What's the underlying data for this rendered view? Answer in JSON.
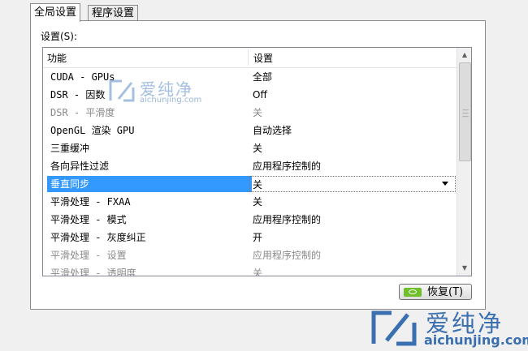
{
  "tabs": [
    {
      "label": "全局设置"
    },
    {
      "label": "程序设置"
    }
  ],
  "settings_label": "设置(S):",
  "table": {
    "columns": [
      "功能",
      "设置"
    ],
    "rows": [
      {
        "feature": "CUDA - GPUs",
        "value": "全部"
      },
      {
        "feature": "DSR - 因数",
        "value": "Off"
      },
      {
        "feature": "DSR - 平滑度",
        "value": "关"
      },
      {
        "feature": "OpenGL 渲染 GPU",
        "value": "自动选择"
      },
      {
        "feature": "三重缓冲",
        "value": "关"
      },
      {
        "feature": "各向异性过滤",
        "value": "应用程序控制的"
      },
      {
        "feature": "垂直同步",
        "value": "关"
      },
      {
        "feature": "平滑处理 - FXAA",
        "value": "关"
      },
      {
        "feature": "平滑处理 - 模式",
        "value": "应用程序控制的"
      },
      {
        "feature": "平滑处理 - 灰度纠正",
        "value": "开"
      },
      {
        "feature": "平滑处理 - 设置",
        "value": "应用程序控制的"
      },
      {
        "feature": "平滑处理 - 透明度",
        "value": "关"
      }
    ]
  },
  "restore_button": "恢复(T)",
  "watermark": {
    "brand": "爱纯净",
    "url": "aichunjing.com"
  },
  "colors": {
    "selection": "#3399ff",
    "nvidia_green": "#6fbf2b"
  }
}
